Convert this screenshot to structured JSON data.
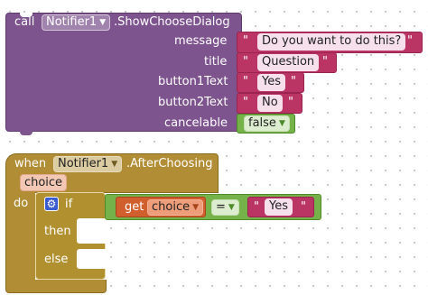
{
  "call_block": {
    "call_label": "call",
    "component": "Notifier1",
    "method": ".ShowChooseDialog",
    "params": [
      {
        "label": "message",
        "value": "Do you want to do this?"
      },
      {
        "label": "title",
        "value": "Question"
      },
      {
        "label": "button1Text",
        "value": "Yes"
      },
      {
        "label": "button2Text",
        "value": "No"
      }
    ],
    "cancelable_label": "cancelable",
    "cancelable_value": "false"
  },
  "event_block": {
    "when_label": "when",
    "component": "Notifier1",
    "event": ".AfterChoosing",
    "param": "choice",
    "do_label": "do",
    "if_label": "if",
    "then_label": "then",
    "else_label": "else",
    "get_label": "get",
    "get_var": "choice",
    "compare_op": "=",
    "compare_value": "Yes"
  },
  "quote_char": "\"",
  "colors": {
    "call_block": "#7e548e",
    "string_block": "#bb3564",
    "logic_block": "#75b24a",
    "event_block": "#b18e35",
    "control_block": "#b1902f",
    "variable_block": "#d05f2d"
  },
  "icons": [
    "chevron-down-icon",
    "gear-icon"
  ]
}
